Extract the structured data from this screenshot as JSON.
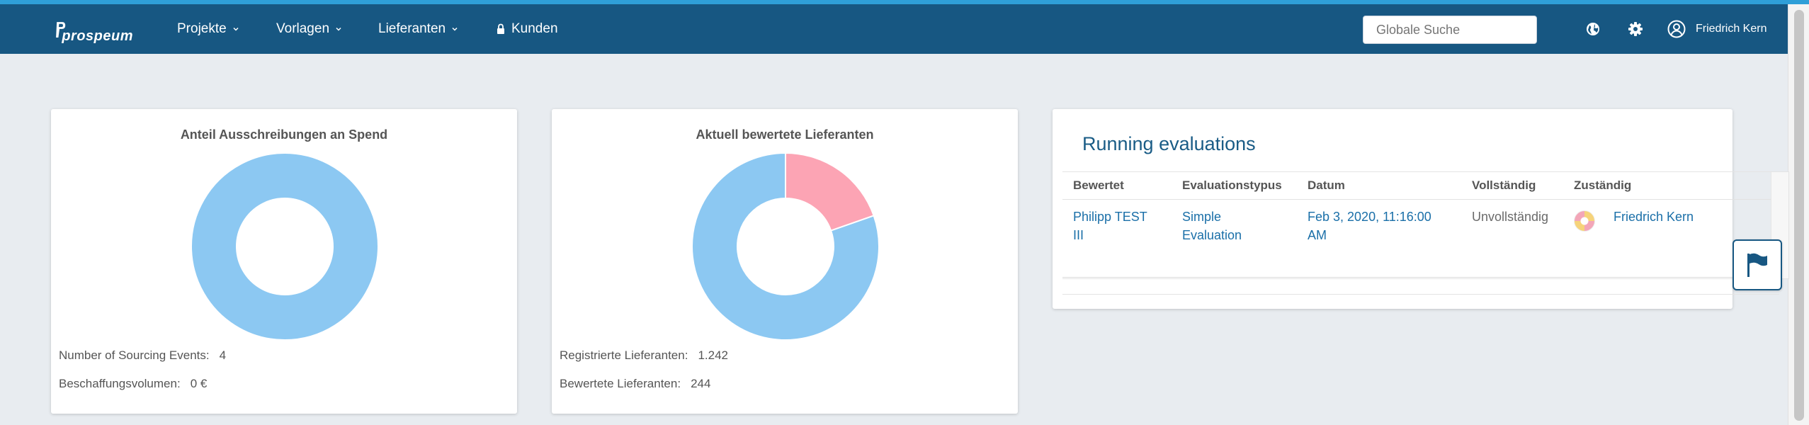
{
  "brand": {
    "name": "prospeum"
  },
  "nav": {
    "items": [
      {
        "label": "Projekte"
      },
      {
        "label": "Vorlagen"
      },
      {
        "label": "Lieferanten"
      },
      {
        "label": "Kunden"
      }
    ],
    "search_placeholder": "Globale Suche",
    "user_name": "Friedrich Kern"
  },
  "colors": {
    "nav_bg": "#175782",
    "accent_line": "#2f9fd8",
    "donut_blue": "#8cc8f2",
    "donut_pink": "#fca4b4",
    "link": "#1a6fa8"
  },
  "cards": {
    "spend": {
      "title": "Anteil Ausschreibungen an Spend",
      "stats": [
        {
          "label": "Number of Sourcing Events:",
          "value": "4"
        },
        {
          "label": "Beschaffungsvolumen:",
          "value": "0 €"
        }
      ]
    },
    "suppliers": {
      "title": "Aktuell bewertete Lieferanten",
      "stats": [
        {
          "label": "Registrierte Lieferanten:",
          "value": "1.242"
        },
        {
          "label": "Bewertete Lieferanten:",
          "value": "244"
        }
      ]
    },
    "evaluations": {
      "title": "Running evaluations",
      "columns": [
        "Bewertet",
        "Evaluationstypus",
        "Datum",
        "Vollständig",
        "Zuständig"
      ],
      "rows": [
        {
          "rated": "Philipp TEST III",
          "type": "Simple Evaluation",
          "date": "Feb 3, 2020, 11:16:00 AM",
          "complete": "Unvollständig",
          "responsible": "Friedrich Kern"
        }
      ]
    }
  },
  "chart_data": [
    {
      "type": "pie",
      "categories": [
        "",
        ""
      ],
      "values": [
        0,
        100
      ],
      "colors": [
        "#fca4b4",
        "#8cc8f2"
      ]
    },
    {
      "type": "pie",
      "categories": [
        "",
        ""
      ],
      "values": [
        244,
        998
      ],
      "colors": [
        "#fca4b4",
        "#8cc8f2"
      ]
    }
  ]
}
